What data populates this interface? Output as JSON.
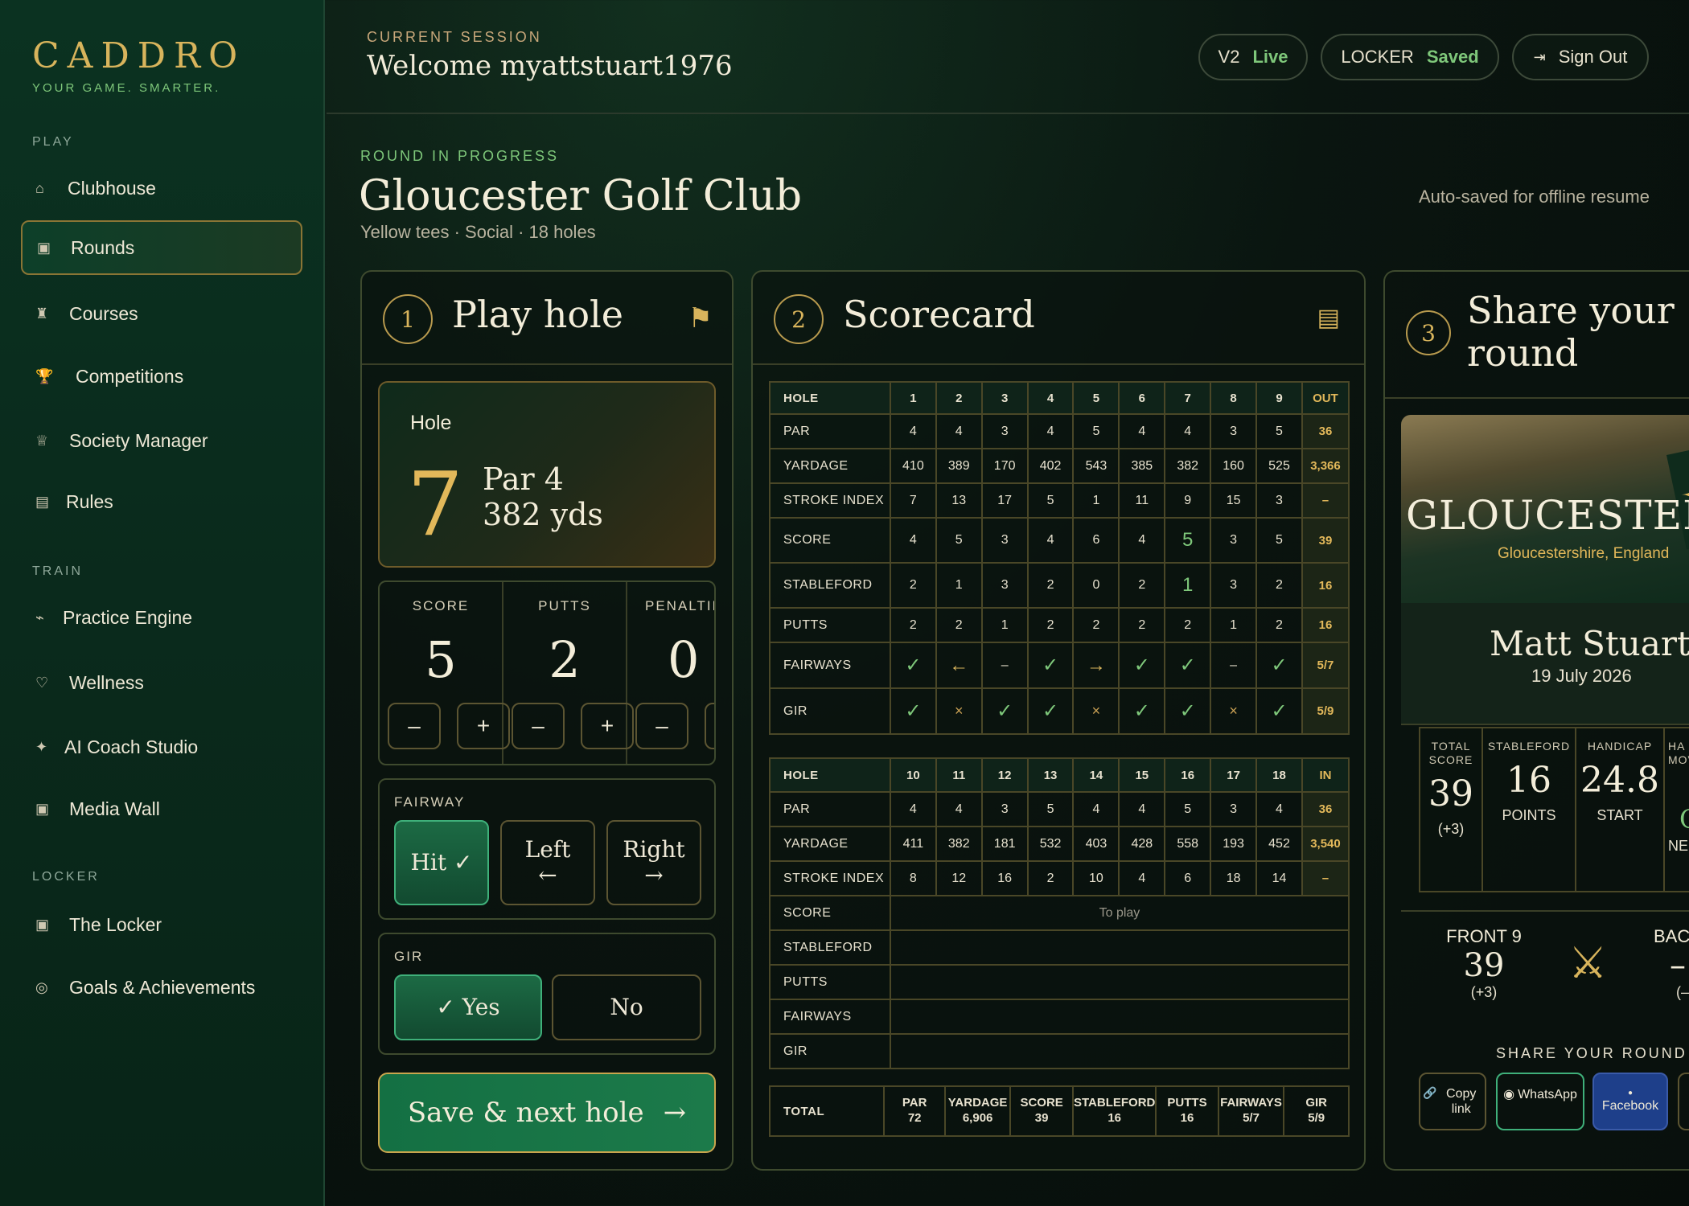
{
  "brand": {
    "name": "CADDRO",
    "tagline": "YOUR GAME. SMARTER."
  },
  "sidebar": {
    "sections": [
      "PLAY",
      "TRAIN",
      "LOCKER"
    ],
    "items": [
      {
        "label": "Clubhouse",
        "icon": "⌂"
      },
      {
        "label": "Rounds",
        "icon": "▣"
      },
      {
        "label": "Courses",
        "icon": "♜"
      },
      {
        "label": "Competitions",
        "icon": "🏆"
      },
      {
        "label": "Society Manager",
        "icon": "♕"
      },
      {
        "label": "Rules",
        "icon": "▤"
      },
      {
        "label": "Practice Engine",
        "icon": "⌁"
      },
      {
        "label": "Wellness",
        "icon": "♡"
      },
      {
        "label": "AI Coach Studio",
        "icon": "✦"
      },
      {
        "label": "Media Wall",
        "icon": "▣"
      },
      {
        "label": "The Locker",
        "icon": "▣"
      },
      {
        "label": "Goals & Achievements",
        "icon": "◎"
      }
    ]
  },
  "header": {
    "session_label": "CURRENT SESSION",
    "welcome": "Welcome myattstuart1976",
    "version": "V2",
    "version_status": "Live",
    "locker": "LOCKER",
    "locker_status": "Saved",
    "signout_icon": "⇥",
    "signout": "Sign Out"
  },
  "round": {
    "label": "ROUND IN PROGRESS",
    "title": "Gloucester Golf Club",
    "subtitle": "Yellow tees · Social · 18 holes",
    "autosave": "Auto-saved for offline resume"
  },
  "play": {
    "step": "1",
    "title": "Play hole",
    "flag_icon": "⚑",
    "hole_label": "Hole",
    "hole_number": "7",
    "par": "Par 4",
    "yards": "382 yds",
    "score_label": "SCORE",
    "score": "5",
    "putts_label": "PUTTS",
    "putts": "2",
    "penalties_label": "PENALTIES",
    "penalties": "0",
    "minus": "–",
    "plus": "+",
    "fairway_label": "FAIRWAY",
    "fairway_hit": "Hit ✓",
    "fairway_left": "Left",
    "fairway_right": "Right",
    "left_arrow": "←",
    "right_arrow": "→",
    "gir_label": "GIR",
    "gir_yes": "✓  Yes",
    "gir_no": "No",
    "save": "Save & next hole",
    "save_arrow": "→"
  },
  "scorecard": {
    "step": "2",
    "title": "Scorecard",
    "icon": "▤",
    "front": {
      "holes": [
        "HOLE",
        "1",
        "2",
        "3",
        "4",
        "5",
        "6",
        "7",
        "8",
        "9",
        "OUT"
      ],
      "rows": [
        [
          "PAR",
          "4",
          "4",
          "3",
          "4",
          "5",
          "4",
          "4",
          "3",
          "5",
          "36"
        ],
        [
          "YARDAGE",
          "410",
          "389",
          "170",
          "402",
          "543",
          "385",
          "382",
          "160",
          "525",
          "3,366"
        ],
        [
          "STROKE INDEX",
          "7",
          "13",
          "17",
          "5",
          "1",
          "11",
          "9",
          "15",
          "3",
          "–"
        ],
        [
          "SCORE",
          "4",
          "5",
          "3",
          "4",
          "6",
          "4",
          "5",
          "3",
          "5",
          "39"
        ],
        [
          "STABLEFORD",
          "2",
          "1",
          "3",
          "2",
          "0",
          "2",
          "1",
          "3",
          "2",
          "16"
        ],
        [
          "PUTTS",
          "2",
          "2",
          "1",
          "2",
          "2",
          "2",
          "2",
          "1",
          "2",
          "16"
        ],
        [
          "FAIRWAYS",
          "✓",
          "←",
          "–",
          "✓",
          "→",
          "✓",
          "✓",
          "–",
          "✓",
          "5/7"
        ],
        [
          "GIR",
          "✓",
          "×",
          "✓",
          "✓",
          "×",
          "✓",
          "✓",
          "×",
          "✓",
          "5/9"
        ]
      ]
    },
    "back": {
      "holes": [
        "HOLE",
        "10",
        "11",
        "12",
        "13",
        "14",
        "15",
        "16",
        "17",
        "18",
        "IN"
      ],
      "rows": [
        [
          "PAR",
          "4",
          "4",
          "3",
          "5",
          "4",
          "4",
          "5",
          "3",
          "4",
          "36"
        ],
        [
          "YARDAGE",
          "411",
          "382",
          "181",
          "532",
          "403",
          "428",
          "558",
          "193",
          "452",
          "3,540"
        ],
        [
          "STROKE INDEX",
          "8",
          "12",
          "16",
          "2",
          "10",
          "4",
          "6",
          "18",
          "14",
          "–"
        ]
      ],
      "empty_rows": [
        "SCORE",
        "STABLEFORD",
        "PUTTS",
        "FAIRWAYS",
        "GIR"
      ],
      "to_play": "To play"
    },
    "totals": {
      "label": "TOTAL",
      "items": [
        {
          "k": "PAR",
          "v": "72"
        },
        {
          "k": "YARDAGE",
          "v": "6,906"
        },
        {
          "k": "SCORE",
          "v": "39"
        },
        {
          "k": "STABLEFORD",
          "v": "16"
        },
        {
          "k": "PUTTS",
          "v": "16"
        },
        {
          "k": "FAIRWAYS",
          "v": "5/7"
        },
        {
          "k": "GIR",
          "v": "5/9"
        }
      ]
    }
  },
  "share": {
    "step": "3",
    "title_line1": "Share your",
    "title_line2": "round",
    "hero_name": "GLOUCESTER G",
    "hero_place": "Gloucestershire, England",
    "hero_star": "✦",
    "player": "Matt Stuart",
    "date": "19 July 2026",
    "stats": [
      {
        "label": "TOTAL SCORE",
        "value": "39",
        "sub": "(+3)"
      },
      {
        "label": "STABLEFORD",
        "value": "16",
        "sub": "POINTS"
      },
      {
        "label": "HANDICAP",
        "value": "24.8",
        "sub": "START"
      },
      {
        "label": "HA MOV",
        "value": "C",
        "sub": "NE"
      }
    ],
    "front9_label": "FRONT 9",
    "front9_value": "39",
    "front9_sub": "(+3)",
    "clubs_icon": "⚔",
    "back9_label": "BAC",
    "back9_value": "–",
    "back9_sub": "(–",
    "share_label": "SHARE YOUR ROUND",
    "buttons": [
      {
        "icon": "🔗",
        "label": "Copy link"
      },
      {
        "icon": "◉",
        "label": "WhatsApp"
      },
      {
        "icon": "●",
        "label": "Facebook"
      }
    ]
  }
}
